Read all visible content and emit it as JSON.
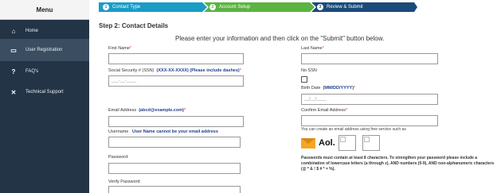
{
  "sidebar": {
    "title": "Menu",
    "items": [
      {
        "label": "Home",
        "icon": "home-icon",
        "glyph": "⌂"
      },
      {
        "label": "User Registration",
        "icon": "folder-icon",
        "glyph": "▭"
      },
      {
        "label": "FAQ's",
        "icon": "question-icon",
        "glyph": "?"
      },
      {
        "label": "Technical Support",
        "icon": "tools-icon",
        "glyph": "✕"
      }
    ]
  },
  "steps": [
    {
      "num": "1",
      "label": "Contact Type"
    },
    {
      "num": "2",
      "label": "Account Setup"
    },
    {
      "num": "3",
      "label": "Review & Submit"
    }
  ],
  "colors": {
    "sidebar": "#243447",
    "step_active": "#1a9cc7",
    "step_done": "#5bb341",
    "step_next": "#1a4a7a"
  },
  "form": {
    "heading": "Step 2: Contact Details",
    "intro": "Please enter your information and then click on the \"Submit\" button below.",
    "first_name_label": "First Name",
    "last_name_label": "Last Name",
    "ssn_label": "Social Security # (SSN)",
    "ssn_format": "(XXX-XX-XXXX) (Please include dashes)",
    "ssn_placeholder": "___-__-____",
    "no_ssn_label": "No SSN",
    "birth_date_label": "Birth Date",
    "birth_date_format": "(MM/DD/YYYY)",
    "birth_date_placeholder": "__/__/____",
    "email_label": "Email Address",
    "email_format": "(abcd@example.com)",
    "confirm_email_label": "Confirm Email Address",
    "free_email_note": "You can create an email address using free service such as",
    "aol_label": "Aol.",
    "username_label": "Username",
    "username_note": "User Name cannot be your email address",
    "password_label": "Password:",
    "password_note": "Passwords must contain at least 8 characters. To strengthen your password please include a combination of lowercase letters (a through z), AND numbers (0-9), AND non-alphanumeric characters (@ * & ! $ # * = %).",
    "verify_password_label": "Verify Password:",
    "required_mark": "*"
  }
}
